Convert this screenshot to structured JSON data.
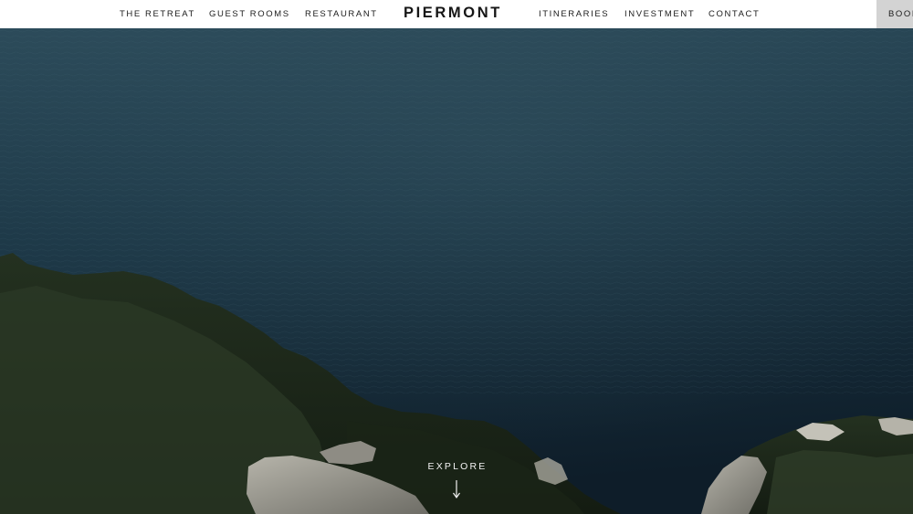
{
  "header": {
    "nav_left": [
      {
        "label": "THE RETREAT"
      },
      {
        "label": "GUEST ROOMS"
      },
      {
        "label": "RESTAURANT"
      }
    ],
    "brand": "PIERMONT",
    "nav_right": [
      {
        "label": "ITINERARIES"
      },
      {
        "label": "INVESTMENT"
      },
      {
        "label": "CONTACT"
      }
    ],
    "book_label": "BOOK"
  },
  "hero": {
    "cta_label": "EXPLORE",
    "cta_icon": "arrow-down-icon"
  },
  "colors": {
    "header_bg": "#ffffff",
    "nav_text": "#1b1b1b",
    "book_bg": "#d3d3d3",
    "sea_top": "#2b4a59",
    "sea_bottom": "#0f1f2b",
    "foliage": "#1f2a1c",
    "rock": "#9a9a92",
    "cta_text": "#f2f2f2"
  }
}
